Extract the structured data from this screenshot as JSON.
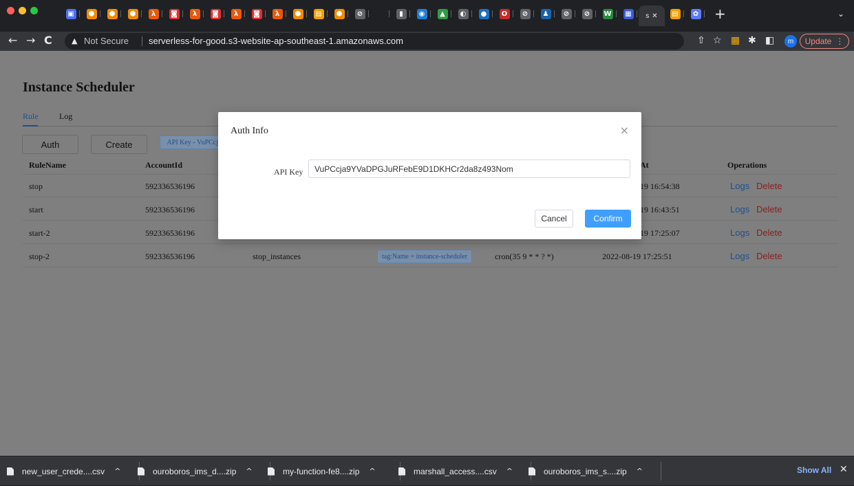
{
  "browser": {
    "new_tab": "+",
    "tab_more": "⌄",
    "active_tab_label": "s",
    "favicons": [
      {
        "icon": "generic-doc-icon",
        "color": "#4c6ef5",
        "glyph": "▣"
      },
      {
        "icon": "aws-cube-icon",
        "color": "#f08c00",
        "glyph": "⬢"
      },
      {
        "icon": "aws-cube-icon",
        "color": "#f08c00",
        "glyph": "⬢"
      },
      {
        "icon": "aws-cube-icon",
        "color": "#f08c00",
        "glyph": "⬢"
      },
      {
        "icon": "lambda-icon",
        "color": "#e8590c",
        "glyph": "λ"
      },
      {
        "icon": "aws-console-icon",
        "color": "#e03131",
        "glyph": "◙"
      },
      {
        "icon": "lambda-icon",
        "color": "#e8590c",
        "glyph": "λ"
      },
      {
        "icon": "aws-console-icon",
        "color": "#e03131",
        "glyph": "◙"
      },
      {
        "icon": "lambda-icon",
        "color": "#e8590c",
        "glyph": "λ"
      },
      {
        "icon": "aws-console-icon",
        "color": "#e03131",
        "glyph": "◙"
      },
      {
        "icon": "lambda-icon",
        "color": "#e8590c",
        "glyph": "λ"
      },
      {
        "icon": "aws-cube-icon",
        "color": "#f08c00",
        "glyph": "⬢"
      },
      {
        "icon": "package-icon",
        "color": "#f59f00",
        "glyph": "▤"
      },
      {
        "icon": "aws-cube-icon",
        "color": "#f08c00",
        "glyph": "⬢"
      },
      {
        "icon": "globe-icon",
        "color": "#5f6368",
        "glyph": "⊘"
      },
      {
        "icon": "blank-icon",
        "color": "#202124",
        "glyph": ""
      },
      {
        "icon": "doc-icon",
        "color": "#5f6368",
        "glyph": "▮"
      },
      {
        "icon": "chat-icon",
        "color": "#1c7ed6",
        "glyph": "◉"
      },
      {
        "icon": "mountain-icon",
        "color": "#2f9e44",
        "glyph": "▲"
      },
      {
        "icon": "github-icon",
        "color": "#5f6368",
        "glyph": "◐"
      },
      {
        "icon": "blue-dot-icon",
        "color": "#1971c2",
        "glyph": "●"
      },
      {
        "icon": "opera-icon",
        "color": "#c92a2a",
        "glyph": "O"
      },
      {
        "icon": "globe-icon",
        "color": "#5f6368",
        "glyph": "⊘"
      },
      {
        "icon": "person-icon",
        "color": "#1864ab",
        "glyph": "♟"
      },
      {
        "icon": "globe-icon",
        "color": "#5f6368",
        "glyph": "⊘"
      },
      {
        "icon": "globe-icon",
        "color": "#5f6368",
        "glyph": "⊘"
      },
      {
        "icon": "w-icon",
        "color": "#2b8a3e",
        "glyph": "W"
      },
      {
        "icon": "app-icon",
        "color": "#3b5bdb",
        "glyph": "▦"
      }
    ],
    "favicons_after": [
      {
        "icon": "package-icon",
        "color": "#f59f00",
        "glyph": "▤"
      },
      {
        "icon": "teams-icon",
        "color": "#5c7cfa",
        "glyph": "✿"
      }
    ],
    "address": {
      "security_text": "Not Secure",
      "url": "serverless-for-good.s3-website-ap-southeast-1.amazonaws.com"
    },
    "profile_initial": "m",
    "update_label": "Update"
  },
  "page": {
    "title": "Instance Scheduler",
    "tabs": [
      {
        "label": "Rule"
      },
      {
        "label": "Log"
      }
    ],
    "toolbar": {
      "auth_label": "Auth",
      "create_label": "Create",
      "api_key_tag": "API Key - VuPCcja"
    },
    "table": {
      "headers": [
        "RuleName",
        "AccountId",
        "",
        "",
        "",
        "At",
        "Operations"
      ],
      "rows": [
        {
          "name": "stop",
          "account": "592336536196",
          "action": "",
          "tag": "",
          "cron": "",
          "updated": "19 16:54:38"
        },
        {
          "name": "start",
          "account": "592336536196",
          "action": "",
          "tag": "",
          "cron": "",
          "updated": "19 16:43:51"
        },
        {
          "name": "start-2",
          "account": "592336536196",
          "action": "",
          "tag": "",
          "cron": "",
          "updated": "19 17:25:07"
        },
        {
          "name": "stop-2",
          "account": "592336536196",
          "action": "stop_instances",
          "tag": "tag:Name = instance-scheduler",
          "cron": "cron(35 9 * * ? *)",
          "updated": "2022-08-19 17:25:51"
        }
      ],
      "logs_label": "Logs",
      "delete_label": "Delete"
    }
  },
  "modal": {
    "title": "Auth Info",
    "close_glyph": "×",
    "field_label": "API Key",
    "field_value": "VuPCcja9YVaDPGJuRFebE9D1DKHCr2da8z493Nom",
    "cancel_label": "Cancel",
    "confirm_label": "Confirm"
  },
  "downloads": {
    "items": [
      {
        "name": "new_user_crede....csv"
      },
      {
        "name": "ouroboros_ims_d....zip"
      },
      {
        "name": "my-function-fe8....zip"
      },
      {
        "name": "marshall_access....csv"
      },
      {
        "name": "ouroboros_ims_s....zip"
      }
    ],
    "show_all": "Show All",
    "close_glyph": "✕"
  }
}
